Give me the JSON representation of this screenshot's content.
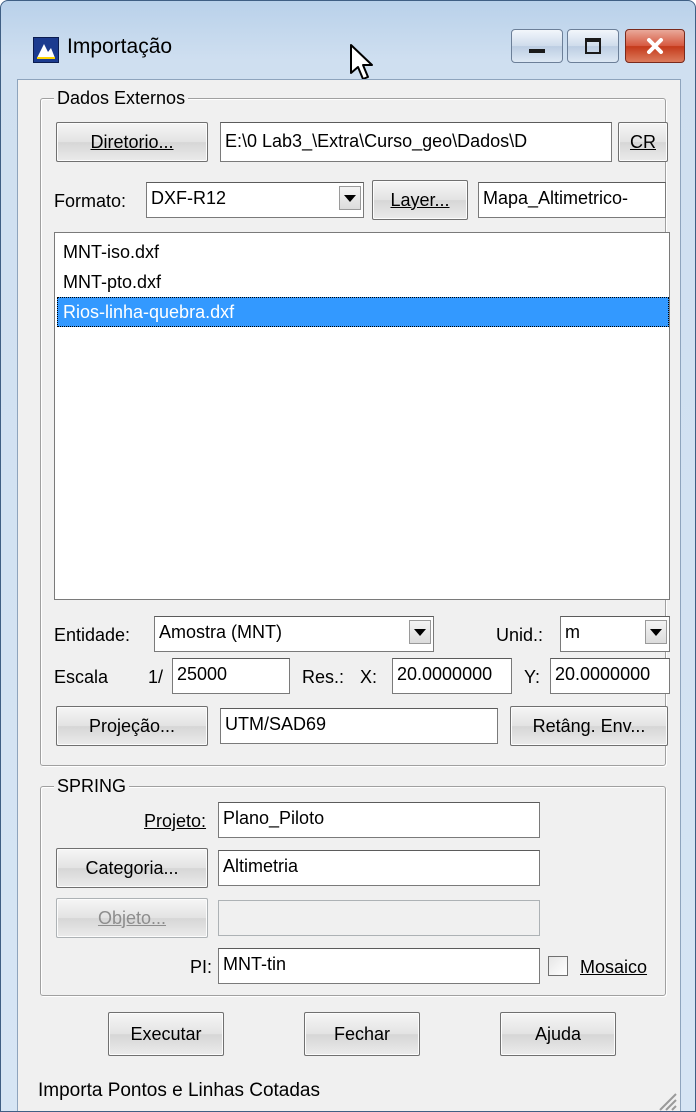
{
  "window": {
    "title": "Importação"
  },
  "dados_externos": {
    "legend": "Dados Externos",
    "diretorio_button": "Diretorio...",
    "diretorio_path": "E:\\0 Lab3_\\Extra\\Curso_geo\\Dados\\D",
    "cr_button": "CR",
    "formato_label": "Formato:",
    "formato_value": "DXF-R12",
    "layer_button": "Layer...",
    "layer_value": "Mapa_Altimetrico-",
    "files": [
      {
        "name": "MNT-iso.dxf",
        "selected": false
      },
      {
        "name": "MNT-pto.dxf",
        "selected": false
      },
      {
        "name": "Rios-linha-quebra.dxf",
        "selected": true
      }
    ],
    "entidade_label": "Entidade:",
    "entidade_value": "Amostra (MNT)",
    "unid_label": "Unid.:",
    "unid_value": "m",
    "escala_label": "Escala",
    "escala_prefix": "1/",
    "escala_value": "25000",
    "res_label": "Res.:",
    "x_label": "X:",
    "x_value": "20.0000000",
    "y_label": "Y:",
    "y_value": "20.0000000",
    "projecao_button": "Projeção...",
    "projecao_value": "UTM/SAD69",
    "retang_button": "Retâng. Env..."
  },
  "spring": {
    "legend": "SPRING",
    "projeto_label": "Projeto:",
    "projeto_value": "Plano_Piloto",
    "categoria_button": "Categoria...",
    "categoria_value": "Altimetria",
    "objeto_button": "Objeto...",
    "objeto_value": "",
    "pi_label": "PI:",
    "pi_value": "MNT-tin",
    "mosaico_label": "Mosaico",
    "mosaico_checked": false
  },
  "actions": {
    "executar": "Executar",
    "fechar": "Fechar",
    "ajuda": "Ajuda"
  },
  "status_text": "Importa Pontos e Linhas Cotadas",
  "colors": {
    "selection": "#3399ff",
    "close_button": "#c4391a",
    "title_bar": "#b9d1ea"
  }
}
